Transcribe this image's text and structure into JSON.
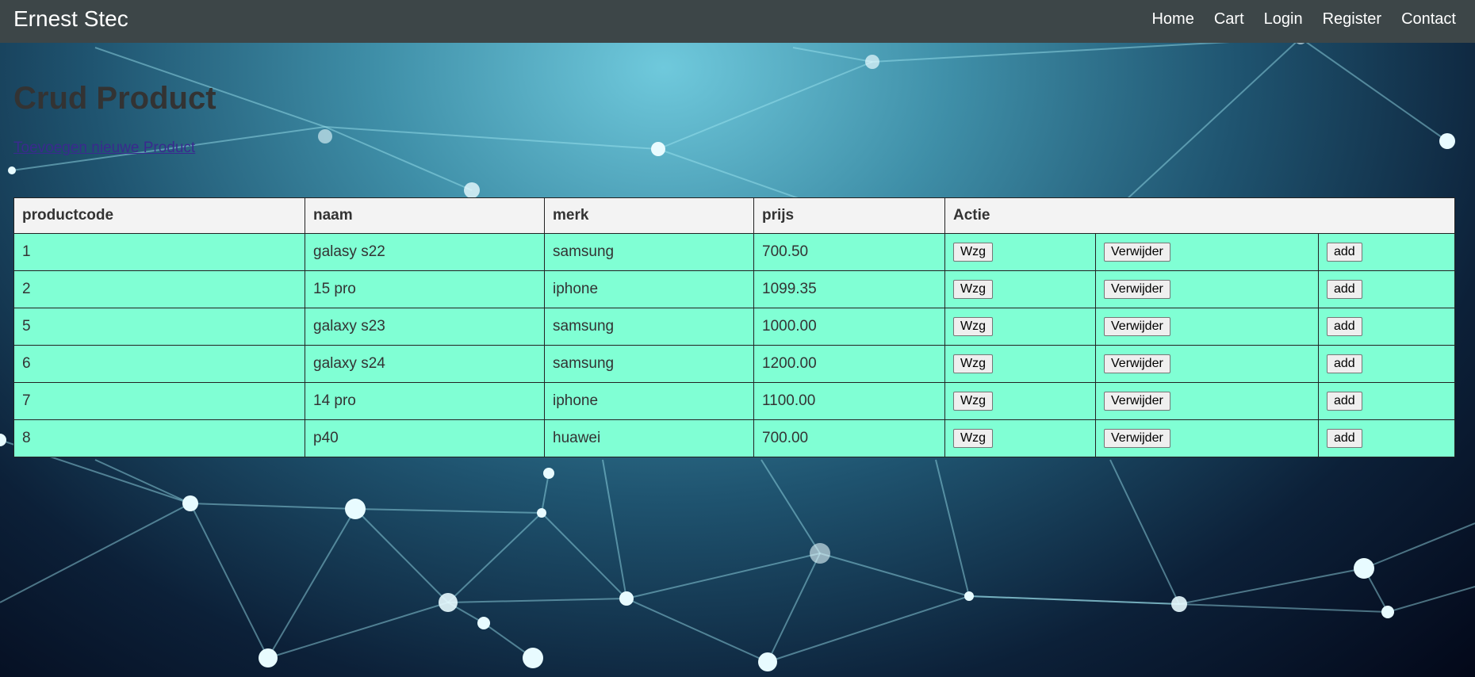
{
  "nav": {
    "brand": "Ernest Stec",
    "links": [
      "Home",
      "Cart",
      "Login",
      "Register",
      "Contact"
    ]
  },
  "main": {
    "title": "Crud Product",
    "add_link": "Toevoegen nieuwe Product"
  },
  "table": {
    "headers": [
      "productcode",
      "naam",
      "merk",
      "prijs",
      "Actie"
    ],
    "rows": [
      {
        "code": "1",
        "naam": "galasy s22",
        "merk": "samsung",
        "prijs": "700.50"
      },
      {
        "code": "2",
        "naam": "15 pro",
        "merk": "iphone",
        "prijs": "1099.35"
      },
      {
        "code": "5",
        "naam": "galaxy s23",
        "merk": "samsung",
        "prijs": "1000.00"
      },
      {
        "code": "6",
        "naam": "galaxy s24",
        "merk": "samsung",
        "prijs": "1200.00"
      },
      {
        "code": "7",
        "naam": "14 pro",
        "merk": "iphone",
        "prijs": "1100.00"
      },
      {
        "code": "8",
        "naam": "p40",
        "merk": "huawei",
        "prijs": "700.00"
      }
    ],
    "actions": {
      "edit": "Wzg",
      "delete": "Verwijder",
      "add": "add"
    }
  },
  "colors": {
    "navbar": "#3d4648",
    "row_background": "#80ffd4",
    "header_background": "#f3f3f3",
    "link": "#3a2a8e"
  }
}
